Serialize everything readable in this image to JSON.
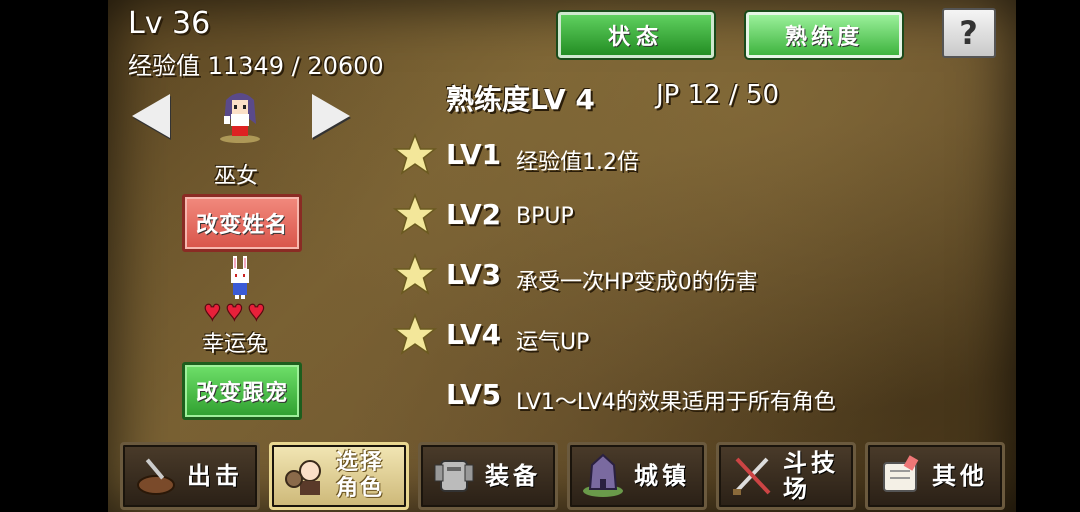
{
  "player": {
    "level_label": "Lv 36",
    "exp_label": "经验值 11349 / 20600"
  },
  "character": {
    "class_name": "巫女",
    "rename_button": "改变姓名"
  },
  "pet": {
    "name": "幸运兔",
    "hearts": 3,
    "change_button": "改变跟宠"
  },
  "tabs": {
    "status": "状态",
    "mastery": "熟练度",
    "help": "?"
  },
  "mastery": {
    "title": "熟练度LV  4",
    "jp": "JP 12 / 50",
    "rows": [
      {
        "level": "LV1",
        "desc": "经验值1.2倍",
        "starred": true
      },
      {
        "level": "LV2",
        "desc": "BPUP",
        "starred": true
      },
      {
        "level": "LV3",
        "desc": "承受一次HP变成0的伤害",
        "starred": true
      },
      {
        "level": "LV4",
        "desc": "运气UP",
        "starred": true
      },
      {
        "level": "LV5",
        "desc": "LV1～LV4的效果适用于所有角色",
        "starred": false
      }
    ]
  },
  "nav": [
    {
      "label": "出击",
      "icon": "sortie-icon"
    },
    {
      "label": "选择\n角色",
      "icon": "character-select-icon"
    },
    {
      "label": "装备",
      "icon": "armor-icon"
    },
    {
      "label": "城镇",
      "icon": "town-icon"
    },
    {
      "label": "斗技场",
      "icon": "arena-swords-icon"
    },
    {
      "label": "其他",
      "icon": "scroll-icon"
    }
  ],
  "colors": {
    "green_button": "#3fb43f",
    "red_button": "#d8544a",
    "star": "#f3e79a"
  }
}
